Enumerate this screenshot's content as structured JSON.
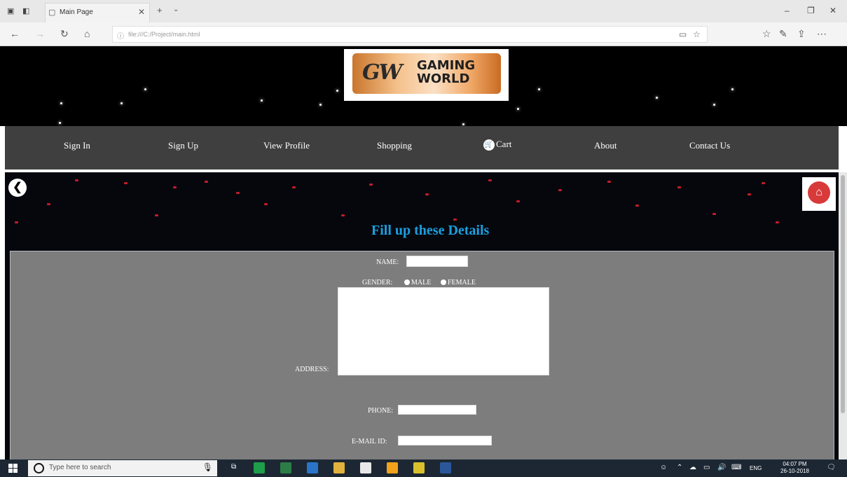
{
  "browser": {
    "tab_title": "Main Page",
    "url": "file:///C:/Project/main.html",
    "icons": [
      "tab-aside-icon",
      "tab-preview-icon",
      "page-icon",
      "close-icon",
      "plus-icon",
      "chevron-down-icon",
      "back-icon",
      "forward-icon",
      "refresh-icon",
      "home-icon",
      "info-icon",
      "reading-view-icon",
      "favorite-star-icon",
      "favorites-icon",
      "pen-icon",
      "share-icon",
      "more-icon"
    ]
  },
  "site": {
    "logo": {
      "mark": "GW",
      "line1": "GAMING",
      "line2": "WORLD"
    },
    "nav": {
      "sign_in": "Sign In",
      "sign_up": "Sign Up",
      "view_profile": "View Profile",
      "shopping": "Shopping",
      "cart": "Cart",
      "about": "About",
      "contact_us": "Contact Us"
    },
    "form": {
      "title": "Fill up these Details",
      "name_label": "NAME:",
      "name_value": "",
      "gender_label": "GENDER:",
      "gender_options": [
        "MALE",
        "FEMALE"
      ],
      "address_label": "ADDRESS:",
      "address_value": "",
      "phone_label": "PHONE:",
      "phone_value": "",
      "email_label": "E-MAIL ID:",
      "email_value": ""
    }
  },
  "taskbar": {
    "search_placeholder": "Type here to search",
    "language": "ENG",
    "time": "04:07 PM",
    "date": "26-10-2018"
  },
  "colors": {
    "nav_bg": "#3f3f3f",
    "form_bg": "#7d7d7d",
    "title_blue": "#1a9fe0",
    "taskbar": "#1c2733"
  }
}
